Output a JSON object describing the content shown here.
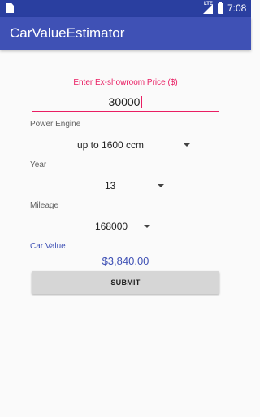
{
  "status_bar": {
    "network_type": "LTE",
    "time": "7:08",
    "icons": [
      "sd-card-icon",
      "signal-icon",
      "battery-icon"
    ]
  },
  "app_bar": {
    "title": "CarValueEstimator",
    "color": "#3f51b5"
  },
  "form": {
    "price_label": "Enter Ex-showroom Price ($)",
    "price_value": "30000",
    "engine_label": "Power Engine",
    "engine_value": "up to 1600 ccm",
    "year_label": "Year",
    "year_value": "13",
    "mileage_label": "Mileage",
    "mileage_value": "168000",
    "result_label": "Car Value",
    "result_value": "$3,840.00",
    "submit_label": "SUBMIT"
  },
  "colors": {
    "accent": "#e91e63",
    "primary": "#3f51b5",
    "primary_dark": "#2a3fa0"
  }
}
